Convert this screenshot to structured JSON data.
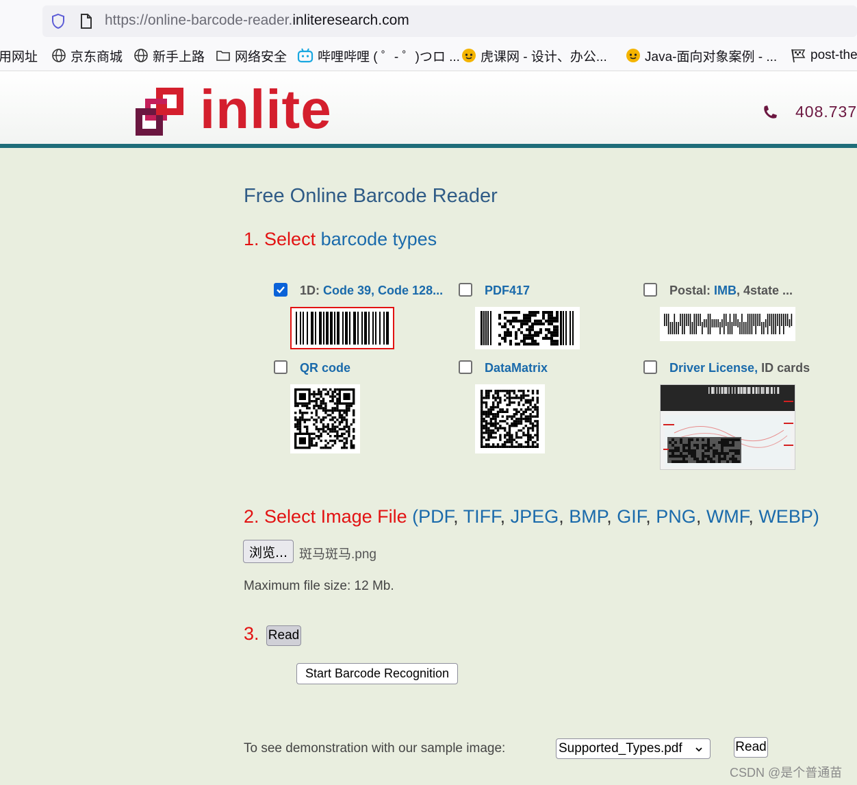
{
  "browser": {
    "url_prefix": "https://online-barcode-reader.",
    "url_domain": "inliteresearch.com",
    "bookmarks": [
      {
        "label": "用网址",
        "icon": "none"
      },
      {
        "label": "京东商城",
        "icon": "globe-icon"
      },
      {
        "label": "新手上路",
        "icon": "globe-icon"
      },
      {
        "label": "网络安全",
        "icon": "folder-icon"
      },
      {
        "label": "哔哩哔哩 ( ゜- ゜)つロ ...",
        "icon": "bilibili-icon"
      },
      {
        "label": "虎课网 - 设计、办公...",
        "icon": "hukewang-icon"
      },
      {
        "label": "Java-面向对象案例 - ...",
        "icon": "hukewang-icon"
      },
      {
        "label": "post-the",
        "icon": "flag-icon"
      }
    ]
  },
  "header": {
    "logo_text": "inlite",
    "phone": "408.737"
  },
  "main": {
    "title": "Free Online Barcode Reader",
    "step1": {
      "num": "1. ",
      "action": "Select",
      "rest": " barcode types"
    },
    "options": [
      {
        "prefix": "1D: ",
        "label": "Code 39, Code 128...",
        "suffix": "",
        "checked": true
      },
      {
        "prefix": "",
        "label": "PDF417",
        "suffix": "",
        "checked": false
      },
      {
        "prefix": "Postal: ",
        "label": "IMB",
        "suffix": ", 4state ...",
        "checked": false
      },
      {
        "prefix": "",
        "label": "QR code",
        "suffix": "",
        "checked": false
      },
      {
        "prefix": "",
        "label": "DataMatrix",
        "suffix": "",
        "checked": false
      },
      {
        "prefix": "",
        "label": "Driver License,",
        "suffix": " ID cards",
        "checked": false
      }
    ],
    "step2": {
      "num": "2. ",
      "action": "Select Image File",
      "open": " (",
      "formats": [
        "PDF",
        "TIFF",
        "JPEG",
        "BMP",
        "GIF",
        "PNG",
        "WMF",
        "WEBP"
      ],
      "close": ")"
    },
    "browse_label": "浏览...",
    "file_name": "斑马斑马.png",
    "max_size": "Maximum file size: 12 Mb.",
    "step3": {
      "num": "3. "
    },
    "read_label": "Read",
    "start_label": "Start Barcode Recognition",
    "demo_text": "To see demonstration with our sample image:",
    "sample_selected": "Supported_Types.pdf",
    "read2_label": "Read"
  },
  "colors": {
    "accent_red": "#e21212",
    "link_blue": "#1a6aab",
    "teal_bar": "#1e6d79",
    "page_bg": "#e9eedf"
  },
  "watermark": "CSDN @是个普通苗"
}
